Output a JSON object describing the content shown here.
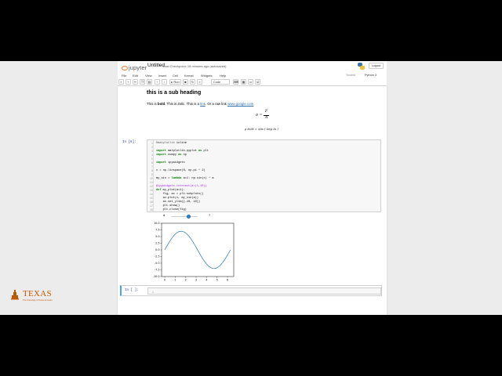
{
  "header": {
    "logo_text": "jupyter",
    "notebook_name": "Untitled",
    "checkpoint_text": "Last Checkpoint: 18 minutes ago  (autosaved)",
    "logout_label": "Logout"
  },
  "menu": {
    "items": [
      "File",
      "Edit",
      "View",
      "Insert",
      "Cell",
      "Kernel",
      "Widgets",
      "Help"
    ],
    "trusted_label": "Trusted",
    "kernel_label": "Python 3"
  },
  "toolbar": {
    "run_label": "Run",
    "cell_type": "Code"
  },
  "markdown": {
    "subheading": "this is a sub heading",
    "para_prefix": "This is ",
    "para_bold": "bold",
    "para_mid": ". This is ",
    "para_italic": "italic",
    "para_mid2": ". This is a ",
    "para_link": "link",
    "para_mid3": ". Or a raw link ",
    "para_raw_link": "www.google.com",
    "eq1_lhs": "σ =",
    "eq1_num": "F",
    "eq1_den": "A",
    "eq2_text": "ρ ∂v/∂t = ∂/∂x ( ∂σ/ρ ∂x )"
  },
  "code_cell": {
    "prompt": "In [8]:",
    "lines": [
      "%matplotlib inline",
      "",
      "import matplotlib.pyplot as plt",
      "import numpy as np",
      "",
      "import ipywidgets",
      "",
      "x = np.linspace(0, np.pi * 2)",
      "",
      "my_sin = lambda a=1: np.sin(x) * a",
      "",
      "@ipywidgets.interact(a=(1,10))",
      "def my_plot(a=1):",
      "    fig, ax = plt.subplots()",
      "    ax.plot(x, my_sin(a))",
      "    ax.set_ylim([-10, 10])",
      "    plt.show()",
      "    plt.close(fig)"
    ]
  },
  "widget": {
    "label": "a",
    "value": "7",
    "min": 1,
    "max": 10
  },
  "chart_data": {
    "type": "line",
    "title": "",
    "xlabel": "",
    "ylabel": "",
    "xlim": [
      -0.3,
      6.6
    ],
    "ylim": [
      -10,
      10
    ],
    "xticks": [
      "0",
      "1",
      "2",
      "3",
      "4",
      "5",
      "6"
    ],
    "yticks": [
      "10.0",
      "7.5",
      "5.0",
      "2.5",
      "0.0",
      "-2.5",
      "-5.0",
      "-7.5",
      "-10.0"
    ],
    "series": [
      {
        "color": "#1f77b4",
        "amplitude": 7,
        "x_start": 0,
        "x_end": 6.283,
        "points": 50
      }
    ],
    "grid": false
  },
  "next_cell": {
    "prompt": "In [ ]:",
    "line_number": "1"
  },
  "brand": {
    "word": "TEXAS",
    "sub": "The University of Texas at Austin",
    "color": "#bf5700"
  },
  "colors": {
    "link": "#296eaa",
    "prompt": "#303f9f",
    "selected_cell": "#42a5f5"
  }
}
